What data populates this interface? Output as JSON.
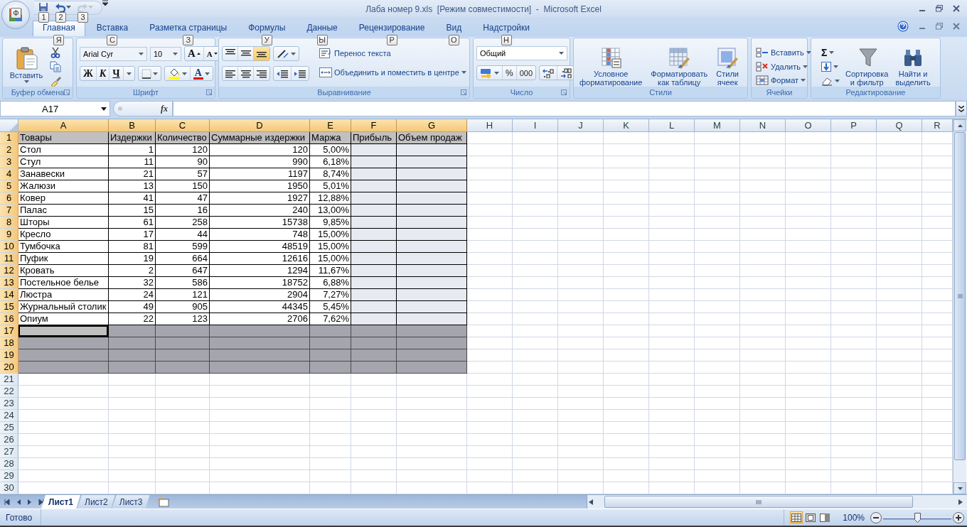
{
  "window": {
    "title": "Лаба номер 9.xls  [Режим совместимости]  -  Microsoft Excel",
    "office_keytip": "Ф",
    "quick_access": [
      {
        "kind": "save",
        "keytip": "1",
        "disabled": false
      },
      {
        "kind": "undo",
        "keytip": "2",
        "disabled": false
      },
      {
        "kind": "redo",
        "keytip": "3",
        "disabled": true
      }
    ]
  },
  "tabs": [
    {
      "label": "Главная",
      "keytip": "Я",
      "selected": true
    },
    {
      "label": "Вставка",
      "keytip": "С",
      "selected": false
    },
    {
      "label": "Разметка страницы",
      "keytip": "З",
      "selected": false
    },
    {
      "label": "Формулы",
      "keytip": "У",
      "selected": false
    },
    {
      "label": "Данные",
      "keytip": "Ы",
      "selected": false
    },
    {
      "label": "Рецензирование",
      "keytip": "Р",
      "selected": false
    },
    {
      "label": "Вид",
      "keytip": "О",
      "selected": false
    },
    {
      "label": "Надстройки",
      "keytip": "Н",
      "selected": false
    }
  ],
  "ribbon": {
    "clipboard": {
      "label": "Буфер обмена",
      "paste": "Вставить"
    },
    "font": {
      "label": "Шрифт",
      "name": "Arial Cyr",
      "size": "10",
      "grow": "A",
      "shrink": "A",
      "bold": "Ж",
      "italic": "К",
      "underline": "Ч",
      "color_letter": "A"
    },
    "alignment": {
      "label": "Выравнивание",
      "vertical": [
        {
          "selected": false
        },
        {
          "selected": false
        },
        {
          "selected": true
        }
      ],
      "wrap": "Перенос текста",
      "merge": "Объединить и поместить в центре"
    },
    "number": {
      "label": "Число",
      "format": "Общий",
      "percent": "%",
      "thousands": "000"
    },
    "styles": {
      "label": "Стили",
      "buttons": [
        {
          "kind": "conditional",
          "label": "Условное\nформатирование"
        },
        {
          "kind": "table",
          "label": "Форматировать\nкак таблицу"
        },
        {
          "kind": "cellstyle",
          "label": "Стили\nячеек"
        }
      ]
    },
    "cells": {
      "label": "Ячейки",
      "buttons": [
        {
          "kind": "insert",
          "label": "Вставить"
        },
        {
          "kind": "delete",
          "label": "Удалить"
        },
        {
          "kind": "format",
          "label": "Формат"
        }
      ]
    },
    "editing": {
      "label": "Редактирование",
      "sum": "Σ",
      "buttons": [
        {
          "kind": "sort",
          "label": "Сортировка\nи фильтр"
        },
        {
          "kind": "find",
          "label": "Найти и\nвыделить"
        }
      ]
    }
  },
  "formula_bar": {
    "name_box": "A17",
    "fx": "fx"
  },
  "sheet": {
    "columns": [
      {
        "label": "A",
        "selected": true,
        "shaded": false
      },
      {
        "label": "B",
        "selected": true,
        "shaded": false
      },
      {
        "label": "C",
        "selected": true,
        "shaded": false
      },
      {
        "label": "D",
        "selected": true,
        "shaded": false
      },
      {
        "label": "E",
        "selected": true,
        "shaded": false
      },
      {
        "label": "F",
        "selected": true,
        "shaded": true
      },
      {
        "label": "G",
        "selected": true,
        "shaded": true
      },
      {
        "label": "H",
        "selected": false
      },
      {
        "label": "I",
        "selected": false
      },
      {
        "label": "J",
        "selected": false
      },
      {
        "label": "K",
        "selected": false
      },
      {
        "label": "L",
        "selected": false
      },
      {
        "label": "M",
        "selected": false
      },
      {
        "label": "N",
        "selected": false
      },
      {
        "label": "O",
        "selected": false
      },
      {
        "label": "P",
        "selected": false
      },
      {
        "label": "Q",
        "selected": false
      },
      {
        "label": "R",
        "selected": false
      }
    ],
    "rows": [
      {
        "number": "1",
        "kind": "header",
        "selected": true,
        "cells": [
          "Товары",
          "Издержки",
          "Количество",
          "Суммарные издержки",
          "Маржа",
          "Прибыль",
          "Объем продаж"
        ]
      },
      {
        "number": "2",
        "kind": "data",
        "selected": true,
        "cells": [
          "Стол",
          "1",
          "120",
          "120",
          "5,00%"
        ]
      },
      {
        "number": "3",
        "kind": "data",
        "selected": true,
        "cells": [
          "Стул",
          "11",
          "90",
          "990",
          "6,18%"
        ]
      },
      {
        "number": "4",
        "kind": "data",
        "selected": true,
        "cells": [
          "Занавески",
          "21",
          "57",
          "1197",
          "8,74%"
        ]
      },
      {
        "number": "5",
        "kind": "data",
        "selected": true,
        "cells": [
          "Жалюзи",
          "13",
          "150",
          "1950",
          "5,01%"
        ]
      },
      {
        "number": "6",
        "kind": "data",
        "selected": true,
        "cells": [
          "Ковер",
          "41",
          "47",
          "1927",
          "12,88%"
        ]
      },
      {
        "number": "7",
        "kind": "data",
        "selected": true,
        "cells": [
          "Палас",
          "15",
          "16",
          "240",
          "13,00%"
        ]
      },
      {
        "number": "8",
        "kind": "data",
        "selected": true,
        "cells": [
          "Шторы",
          "61",
          "258",
          "15738",
          "9,85%"
        ]
      },
      {
        "number": "9",
        "kind": "data",
        "selected": true,
        "cells": [
          "Кресло",
          "17",
          "44",
          "748",
          "15,00%"
        ]
      },
      {
        "number": "10",
        "kind": "data",
        "selected": true,
        "cells": [
          "Тумбочка",
          "81",
          "599",
          "48519",
          "15,00%"
        ]
      },
      {
        "number": "11",
        "kind": "data",
        "selected": true,
        "cells": [
          "Пуфик",
          "19",
          "664",
          "12616",
          "15,00%"
        ]
      },
      {
        "number": "12",
        "kind": "data",
        "selected": true,
        "cells": [
          "Кровать",
          "2",
          "647",
          "1294",
          "11,67%"
        ]
      },
      {
        "number": "13",
        "kind": "data",
        "selected": true,
        "cells": [
          "Постельное белье",
          "32",
          "586",
          "18752",
          "6,88%"
        ]
      },
      {
        "number": "14",
        "kind": "data",
        "selected": true,
        "cells": [
          "Люстра",
          "24",
          "121",
          "2904",
          "7,27%"
        ]
      },
      {
        "number": "15",
        "kind": "data",
        "selected": true,
        "cells": [
          "Журнальный столик",
          "49",
          "905",
          "44345",
          "5,45%"
        ]
      },
      {
        "number": "16",
        "kind": "data",
        "selected": true,
        "cells": [
          "Опиум",
          "22",
          "123",
          "2706",
          "7,62%"
        ]
      },
      {
        "number": "17",
        "kind": "filled",
        "selected": true,
        "active": true
      },
      {
        "number": "18",
        "kind": "filled",
        "selected": true
      },
      {
        "number": "19",
        "kind": "filled",
        "selected": true
      },
      {
        "number": "20",
        "kind": "filled",
        "selected": true
      },
      {
        "number": "21",
        "kind": "empty",
        "selected": false
      },
      {
        "number": "22",
        "kind": "empty",
        "selected": false
      },
      {
        "number": "23",
        "kind": "empty",
        "selected": false
      },
      {
        "number": "24",
        "kind": "empty",
        "selected": false
      },
      {
        "number": "25",
        "kind": "empty",
        "selected": false
      },
      {
        "number": "26",
        "kind": "empty",
        "selected": false
      },
      {
        "number": "27",
        "kind": "empty",
        "selected": false
      },
      {
        "number": "28",
        "kind": "empty",
        "selected": false
      },
      {
        "number": "29",
        "kind": "empty",
        "selected": false
      },
      {
        "number": "30",
        "kind": "empty",
        "selected": false
      }
    ]
  },
  "sheet_tabs": [
    {
      "label": "Лист1",
      "selected": true
    },
    {
      "label": "Лист2",
      "selected": false
    },
    {
      "label": "Лист3",
      "selected": false
    }
  ],
  "status_bar": {
    "text": "Готово",
    "views": [
      {
        "kind": "normal",
        "selected": true
      },
      {
        "kind": "layout",
        "selected": false
      },
      {
        "kind": "pagebreak",
        "selected": false
      }
    ],
    "zoom": "100%",
    "zoom_slider": {
      "level": 0.5
    }
  }
}
